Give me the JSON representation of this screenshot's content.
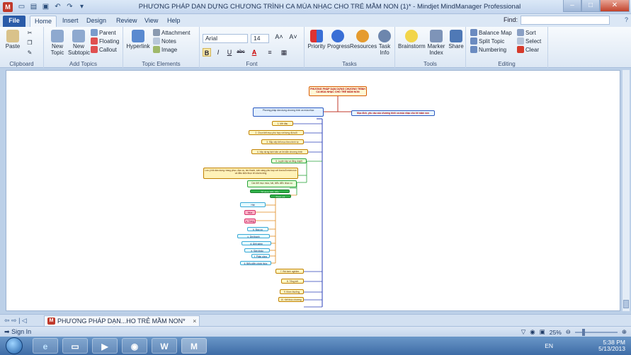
{
  "window": {
    "app_icon": "M",
    "title": "PHƯƠNG PHÁP DẠN DỰNG CHƯƠNG TRÌNH CA MÚA NHẠC CHO TRẺ MẦM NON (1)* - Mindjet MindManager Professional"
  },
  "tabs": [
    "File",
    "Home",
    "Insert",
    "Design",
    "Review",
    "View",
    "Help"
  ],
  "active_tab": "Home",
  "find_label": "Find:",
  "ribbon": {
    "clipboard": {
      "label": "Clipboard",
      "paste": "Paste"
    },
    "add_topics": {
      "label": "Add Topics",
      "new_topic": "New Topic",
      "new_subtopic": "New Subtopic",
      "parent": "Parent",
      "floating": "Floating",
      "callout": "Callout"
    },
    "topic_elements": {
      "label": "Topic Elements",
      "hyperlink": "Hyperlink",
      "attachment": "Attachment",
      "notes": "Notes",
      "image": "Image"
    },
    "font": {
      "label": "Font",
      "family": "Arial",
      "size": "14",
      "bold": "B",
      "italic": "I",
      "underline": "U",
      "strike": "abc"
    },
    "tasks": {
      "label": "Tasks",
      "priority": "Priority",
      "progress": "Progress",
      "resources": "Resources",
      "task_info": "Task Info"
    },
    "tools": {
      "label": "Tools",
      "brainstorm": "Brainstorm",
      "marker_index": "Marker Index",
      "share": "Share"
    },
    "editing": {
      "label": "Editing",
      "balance_map": "Balance Map",
      "sort": "Sort",
      "split_topic": "Split Topic",
      "select": "Select",
      "numbering": "Numbering",
      "clear": "Clear"
    }
  },
  "map": {
    "central": "PHƯƠNG PHÁP DẠN DỰNG CHƯƠNG TRÌNH CA MÚA NHẠC CHO TRẺ MẦM NON",
    "selected_topic": "Phương pháp dàn dựng chương trình ca múa nhạc",
    "right_topic": "Mục đích, yêu cầu của chương trình ca múa nhạc cho trẻ mầm non",
    "left_topics": [
      "1. Mở đầu chương trình",
      "2. Chọn tiết mục phù hợp với từng độ tuổi",
      "3. Sắp xếp tiết mục theo trình tự",
      "4. Xây dựng kịch bản và lời dẫn chương trình",
      "5. Luyện tập và tổng duyệt",
      "Lưu ý khi dàn dựng: trang phục, đạo cụ, âm thanh, ánh sáng phù hợp với lứa tuổi mầm non và điều kiện thực tế của trường",
      "Các tiết mục múa, hát, biểu diễn nhạc cụ",
      "Tổ chức biểu diễn",
      "Đánh giá",
      "Hát",
      "Múa",
      "a. Trang phục",
      "b. Đạo cụ",
      "c. Âm thanh",
      "d. Ánh sáng",
      "e. Sân khấu",
      "f. Phân công người dẫn",
      "6. Biểu diễn chính thức",
      "7. Rút kinh nghiệm",
      "8. Tổng kết",
      "9. Khen thưởng",
      "10. Kết thúc chương trình"
    ]
  },
  "doc_tab": "PHƯƠNG PHÁP DẠN...HO TRẺ MẦM NON*",
  "status": {
    "sign_in": "Sign In",
    "zoom": "25%"
  },
  "taskbar": {
    "lang": "EN",
    "time": "5:38 PM",
    "date": "5/13/2013"
  }
}
